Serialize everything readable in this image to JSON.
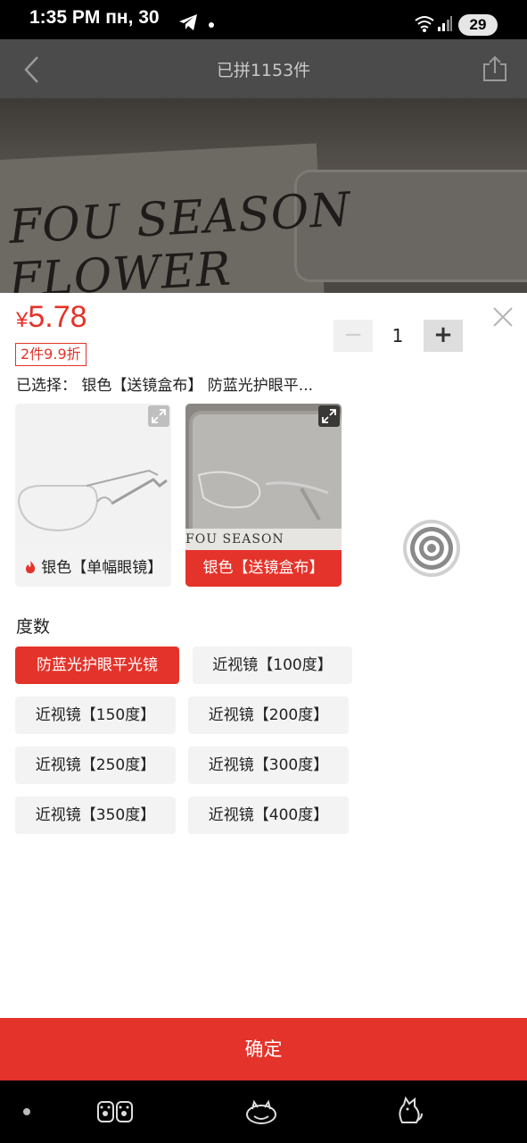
{
  "status_bar": {
    "time": "1:35 PM  пн, 30",
    "battery": "29"
  },
  "header": {
    "title": "已拼1153件"
  },
  "photo": {
    "line1": "FOU SEASON",
    "line2": "FLOWER"
  },
  "product": {
    "price_symbol": "¥",
    "price": "5.78",
    "promo": "2件9.9折",
    "selected": "已选择：  银色【送镜盒布】  防蓝光护眼平..."
  },
  "quantity": {
    "value": "1",
    "minus": "−",
    "plus": "+"
  },
  "variants": [
    {
      "label": "银色【单幅眼镜】",
      "hot": true,
      "selected": false
    },
    {
      "label": "银色【送镜盒布】",
      "hot": false,
      "selected": true
    }
  ],
  "variant_photo_text": "FOU SEASON",
  "section": {
    "title": "度数"
  },
  "options": [
    {
      "label": "防蓝光护眼平光镜",
      "selected": true
    },
    {
      "label": "近视镜【100度】",
      "selected": false
    },
    {
      "label": "近视镜【150度】",
      "selected": false
    },
    {
      "label": "近视镜【200度】",
      "selected": false
    },
    {
      "label": "近视镜【250度】",
      "selected": false
    },
    {
      "label": "近视镜【300度】",
      "selected": false
    },
    {
      "label": "近视镜【350度】",
      "selected": false
    },
    {
      "label": "近视镜【400度】",
      "selected": false
    }
  ],
  "confirm": {
    "label": "确定"
  },
  "colors": {
    "accent": "#e4332a"
  }
}
